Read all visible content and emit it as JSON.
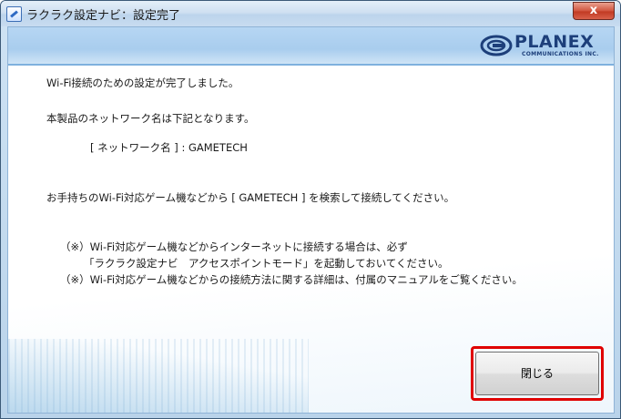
{
  "window": {
    "title": "ラクラク設定ナビ：設定完了",
    "close_glyph": "x"
  },
  "brand": {
    "name": "PLANEX",
    "subtitle": "COMMUNICATIONS INC."
  },
  "message": {
    "line1": "Wi-Fi接続のための設定が完了しました。",
    "line2": "本製品のネットワーク名は下記となります。",
    "network_name_line": "[ ネットワーク名 ] : GAMETECH",
    "line3": "お手持ちのWi-Fi対応ゲーム機などから [ GAMETECH ] を検索して接続してください。",
    "note1_a": "（※）Wi-Fi対応ゲーム機などからインターネットに接続する場合は、必ず",
    "note1_b": "「ラクラク設定ナビ　アクセスポイントモード」を起動しておいてください。",
    "note2": "（※）Wi-Fi対応ゲーム機などからの接続方法に関する詳細は、付属のマニュアルをご覧ください。"
  },
  "buttons": {
    "close_label": "閉じる"
  }
}
